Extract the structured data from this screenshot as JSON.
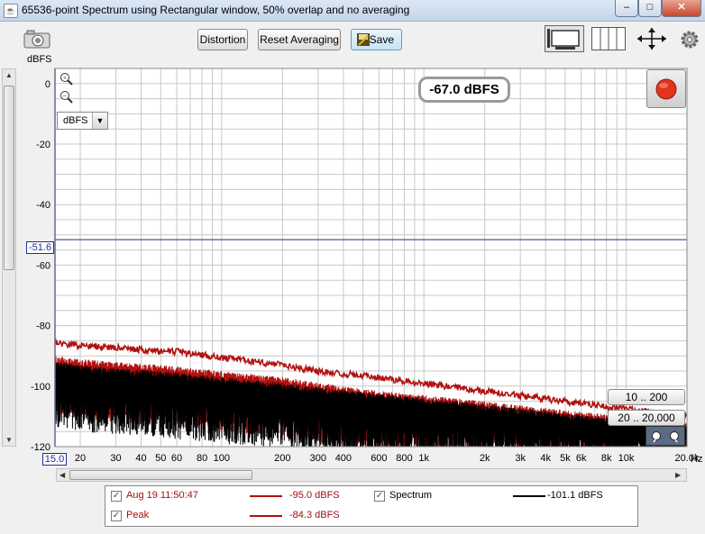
{
  "window": {
    "title": "65536-point Spectrum using Rectangular window, 50% overlap and no averaging",
    "app_icon": "java-cup-icon",
    "controls": {
      "minimize": "–",
      "maximize": "□",
      "close": "✕"
    }
  },
  "toolbar": {
    "distortion_label": "Distortion",
    "reset_label": "Reset Averaging",
    "save_label": "Save",
    "camera_icon": "camera-icon",
    "settings_icon": "gear-icon"
  },
  "readout": {
    "level": "-67.0 dBFS",
    "cursor_level": "-51.6",
    "units_select": "dBFS",
    "y_unit_label": "dBFS",
    "x_start": "15.0",
    "x_unit": "Hz"
  },
  "range_buttons": [
    "10 .. 200",
    "20 .. 20,000"
  ],
  "colors": {
    "plot_bg": "#ffffff",
    "grid": "#c8c8c8",
    "spectrum": "#000000",
    "peak": "#b01010",
    "capture": "#b01010",
    "cursor_line": "#1f2f8f",
    "record_button": "#e2341d"
  },
  "legend": {
    "items": [
      {
        "label": "Aug 19 11:50:47",
        "value": "-95.0 dBFS",
        "checked": true,
        "color": "#b01010"
      },
      {
        "label": "Spectrum",
        "value": "-101.1 dBFS",
        "checked": true,
        "color": "#000000"
      },
      {
        "label": "Peak",
        "value": "-84.3 dBFS",
        "checked": true,
        "color": "#b01010"
      }
    ]
  },
  "chart_data": {
    "type": "line",
    "title": "",
    "xlabel": "Hz",
    "ylabel": "dBFS",
    "x_scale": "log",
    "xlim": [
      15,
      20000
    ],
    "ylim": [
      -120,
      5
    ],
    "x_ticks": [
      {
        "v": 20,
        "label": "20"
      },
      {
        "v": 30,
        "label": "30"
      },
      {
        "v": 40,
        "label": "40"
      },
      {
        "v": 50,
        "label": "50"
      },
      {
        "v": 60,
        "label": "60"
      },
      {
        "v": 80,
        "label": "80"
      },
      {
        "v": 100,
        "label": "100"
      },
      {
        "v": 200,
        "label": "200"
      },
      {
        "v": 300,
        "label": "300"
      },
      {
        "v": 400,
        "label": "400"
      },
      {
        "v": 600,
        "label": "600"
      },
      {
        "v": 800,
        "label": "800"
      },
      {
        "v": 1000,
        "label": "1k"
      },
      {
        "v": 2000,
        "label": "2k"
      },
      {
        "v": 3000,
        "label": "3k"
      },
      {
        "v": 4000,
        "label": "4k"
      },
      {
        "v": 5000,
        "label": "5k"
      },
      {
        "v": 6000,
        "label": "6k"
      },
      {
        "v": 8000,
        "label": "8k"
      },
      {
        "v": 10000,
        "label": "10k"
      },
      {
        "v": 20000,
        "label": "20.0k"
      }
    ],
    "y_ticks": [
      0,
      -20,
      -40,
      -60,
      -80,
      -100,
      -120
    ],
    "cursor_line_y": -51.6,
    "grid": true,
    "series": [
      {
        "name": "Peak",
        "style": "envelope",
        "x": [
          15,
          20,
          30,
          40,
          60,
          80,
          100,
          200,
          300,
          500,
          1000,
          2000,
          5000,
          10000,
          20000
        ],
        "y": [
          -84.5,
          -85.5,
          -86,
          -87,
          -87.5,
          -88.5,
          -89.5,
          -92,
          -94,
          -95.5,
          -98,
          -100.5,
          -104,
          -106.5,
          -109
        ],
        "ripple": 2.2
      },
      {
        "name": "Aug 19 11:50:47",
        "style": "dense",
        "x": [
          15,
          20,
          30,
          50,
          100,
          200,
          500,
          1000,
          2000,
          5000,
          10000,
          20000
        ],
        "top": [
          -90,
          -91,
          -92,
          -93,
          -95,
          -97,
          -101,
          -103,
          -105,
          -108,
          -110,
          -112
        ],
        "depth": [
          20,
          20,
          20,
          20,
          20,
          20,
          20,
          18,
          16,
          14,
          12,
          10
        ]
      },
      {
        "name": "Spectrum",
        "style": "dense",
        "x": [
          15,
          20,
          30,
          50,
          100,
          200,
          500,
          1000,
          2000,
          5000,
          10000,
          20000
        ],
        "top": [
          -92,
          -93,
          -94,
          -95,
          -97,
          -99,
          -102,
          -104,
          -106,
          -109,
          -111,
          -113
        ],
        "depth": [
          22,
          22,
          22,
          22,
          22,
          22,
          22,
          20,
          18,
          14,
          12,
          10
        ]
      }
    ]
  }
}
